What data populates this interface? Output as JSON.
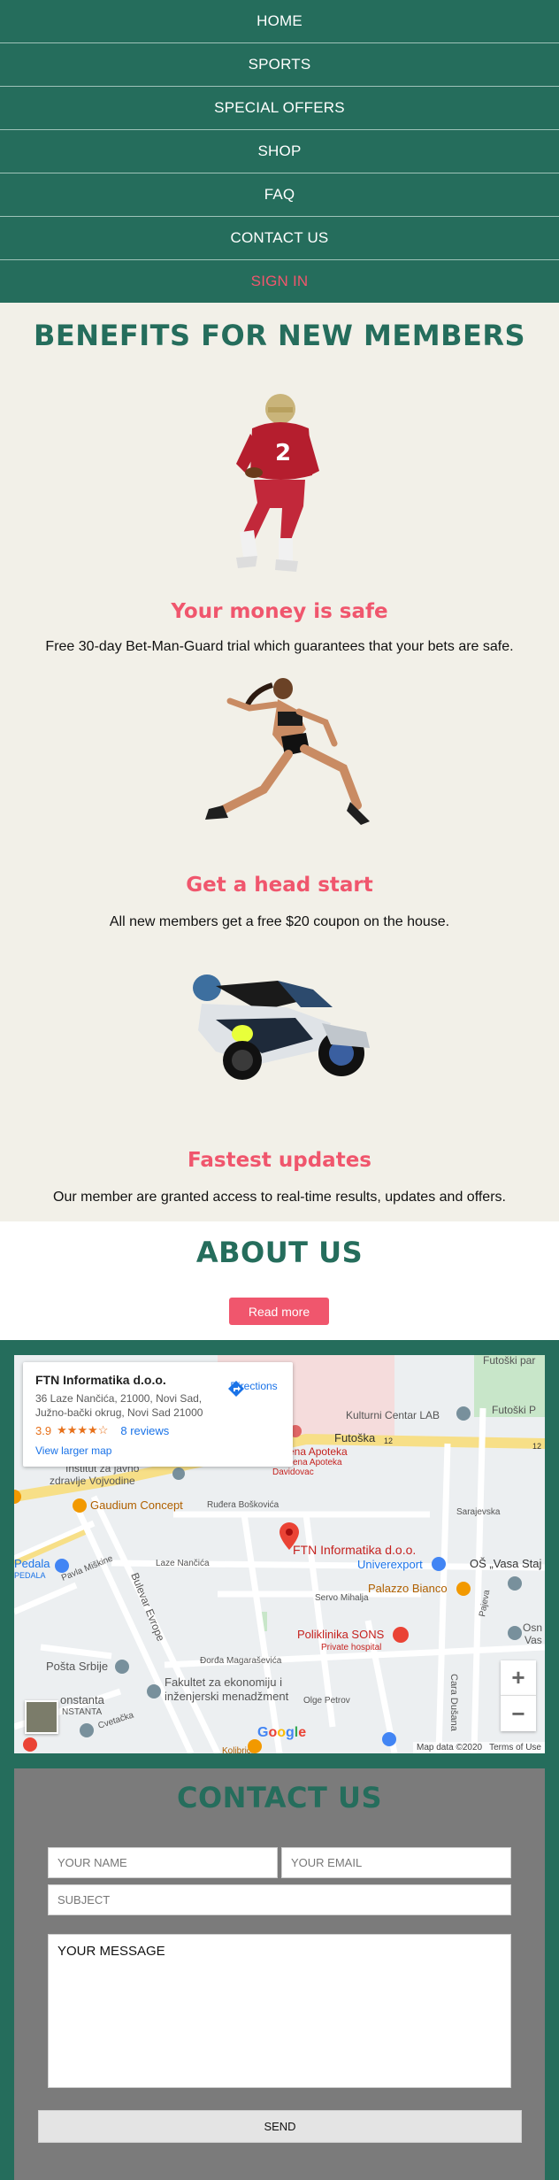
{
  "nav": {
    "items": [
      "HOME",
      "SPORTS",
      "SPECIAL OFFERS",
      "SHOP",
      "FAQ",
      "CONTACT US"
    ],
    "signin": "SIGN IN"
  },
  "benefits": {
    "title": "BENEFITS FOR NEW MEMBERS",
    "items": [
      {
        "heading": "Your money is safe",
        "text": "Free 30-day Bet-Man-Guard trial which guarantees that your bets are safe.",
        "image": "football-player-image"
      },
      {
        "heading": "Get a head start",
        "text": "All new members get a free $20 coupon on the house.",
        "image": "runner-image"
      },
      {
        "heading": "Fastest updates",
        "text": "Our member are granted access to real-time results, updates and offers.",
        "image": "motorcycle-racer-image"
      }
    ]
  },
  "about": {
    "title": "ABOUT US",
    "button": "Read more"
  },
  "map": {
    "card": {
      "name": "FTN Informatika d.o.o.",
      "address": "36 Laze Nančića, 21000, Novi Sad, Južno-bački okrug, Novi Sad 21000",
      "rating": "3.9",
      "stars": "★★★★☆",
      "reviews": "8 reviews",
      "larger_map": "View larger map",
      "directions": "Directions"
    },
    "labels": {
      "futoski_park": "Futoški par",
      "futoski_park2": "Futoški P",
      "kulturni": "Kulturni Centar LAB",
      "futoska": "Futoška",
      "road12a": "12",
      "road12b": "12",
      "apoteka1": "ena Apoteka",
      "apoteka2": "Jena Apoteka",
      "apoteka3": "Davidovac",
      "institut1": "Institut za javno",
      "institut2": "zdravlje Vojvodine",
      "gaudium": "Gaudium Concept",
      "rusdera": "Ruđera Boškovića",
      "sarajevska": "Sarajevska",
      "ftn": "FTN Informatika d.o.o.",
      "univerexport": "Univerexport",
      "pedala1": "Pedala",
      "pedala2": "PEDALA",
      "pavla": "Pavla Miškine",
      "laze": "Laze Nančića",
      "os": "OŠ „Vasa Staj",
      "bulevar": "Bulevar Evrope",
      "servo": "Servo Mihalja",
      "palazzo": "Palazzo Bianco",
      "pajeva": "Pajeva",
      "poliklinika1": "Poliklinika SONS",
      "poliklinika2": "Private hospital",
      "osn": "Osn",
      "vas": "Vas",
      "posta": "Pošta Srbije",
      "djordja": "Đorđa Magaraševića",
      "fakultet1": "Fakultet za ekonomiju i",
      "fakultet2": "inženjerski menadžment",
      "olge": "Olge Petrov",
      "konstanta1": "onstanta",
      "konstanta2": "NSTANTA",
      "cveta": "Cvetačka",
      "cara": "Cara Dušana",
      "kolibri": "Kolibrici"
    },
    "zoom_in": "+",
    "zoom_out": "−",
    "logo": [
      "G",
      "o",
      "o",
      "g",
      "l",
      "e"
    ],
    "logo_colors": [
      "#4285f4",
      "#ea4335",
      "#fbbc05",
      "#4285f4",
      "#34a853",
      "#ea4335"
    ],
    "footer": [
      "Map data ©2020",
      "Terms of Use"
    ]
  },
  "contact": {
    "title": "CONTACT US",
    "name_placeholder": "YOUR NAME",
    "email_placeholder": "YOUR EMAIL",
    "subject_placeholder": "SUBJECT",
    "message_placeholder": "YOUR MESSAGE",
    "send": "SEND"
  },
  "colors": {
    "brand_green": "#256d5c",
    "accent_pink": "#f0566d",
    "benefits_bg": "#f2f0e8",
    "contact_bg": "#7b7b7b"
  }
}
